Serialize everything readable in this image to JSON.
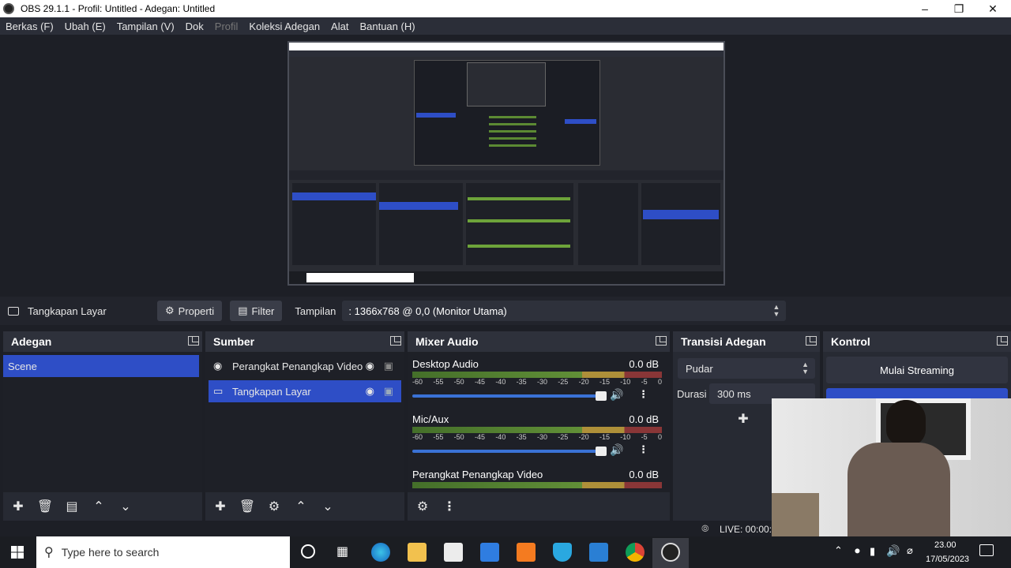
{
  "window": {
    "title": "OBS 29.1.1 - Profil: Untitled - Adegan: Untitled"
  },
  "menu": {
    "items": [
      "Berkas (F)",
      "Ubah (E)",
      "Tampilan (V)",
      "Dok",
      "Profil",
      "Koleksi Adegan",
      "Alat",
      "Bantuan (H)"
    ]
  },
  "source_bar": {
    "source_name": "Tangkapan Layar",
    "properties": "Properti",
    "filter": "Filter",
    "display_label": "Tampilan",
    "display_value": ": 1366x768 @ 0,0 (Monitor Utama)"
  },
  "scenes": {
    "title": "Adegan",
    "items": [
      "Scene"
    ]
  },
  "sources": {
    "title": "Sumber",
    "items": [
      "Perangkat Penangkap Video",
      "Tangkapan Layar"
    ]
  },
  "mixer": {
    "title": "Mixer Audio",
    "ticks": [
      "-60",
      "-55",
      "-50",
      "-45",
      "-40",
      "-35",
      "-30",
      "-25",
      "-20",
      "-15",
      "-10",
      "-5",
      "0"
    ],
    "channels": [
      {
        "name": "Desktop Audio",
        "db": "0.0 dB"
      },
      {
        "name": "Mic/Aux",
        "db": "0.0 dB"
      },
      {
        "name": "Perangkat Penangkap Video",
        "db": "0.0 dB"
      }
    ]
  },
  "transitions": {
    "title": "Transisi Adegan",
    "type": "Pudar",
    "duration_label": "Durasi",
    "duration_value": "300 ms"
  },
  "controls": {
    "title": "Kontrol",
    "start_streaming": "Mulai Streaming"
  },
  "status": {
    "live": "LIVE: 00:00:0"
  },
  "taskbar": {
    "search_placeholder": "Type here to search",
    "time": "23.00",
    "date": "17/05/2023"
  },
  "colors": {
    "accent": "#2e4ec6",
    "panel": "#272a33",
    "background": "#1d1f26"
  }
}
